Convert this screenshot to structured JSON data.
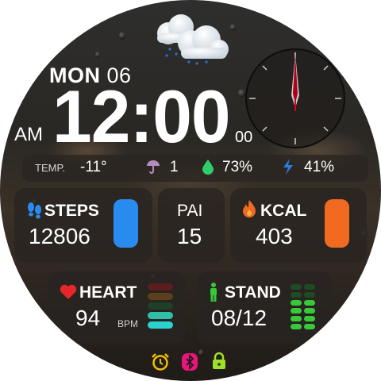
{
  "date": {
    "day": "MON",
    "num": "06"
  },
  "time": {
    "hm": "12:00",
    "ampm": "AM",
    "seconds": "00"
  },
  "status": {
    "temp_label": "TEMP.",
    "temp": "-11°",
    "umbrella": "1",
    "humidity": "73%",
    "battery": "41%"
  },
  "cards": {
    "steps": {
      "label": "STEPS",
      "value": "12806",
      "color": "#2a8bef"
    },
    "pai": {
      "label": "PAI",
      "value": "15"
    },
    "kcal": {
      "label": "KCAL",
      "value": "403",
      "color": "#f06a22"
    },
    "heart": {
      "label": "HEART",
      "value": "94",
      "unit": "BPM",
      "color": "#e5262d"
    },
    "stand": {
      "label": "STAND",
      "value": "08/12",
      "color": "#38c93a"
    }
  },
  "icons": {
    "alarm": "alarm-clock-icon",
    "bluetooth": "bluetooth-icon",
    "lock": "lock-icon"
  },
  "colors": {
    "umbrella": "#b48bbd",
    "drop": "#2ecf6a",
    "bolt": "#2b7de0",
    "alarm": "#f0c000",
    "bluetooth": "#e8157a",
    "lock": "#9ee02a"
  }
}
